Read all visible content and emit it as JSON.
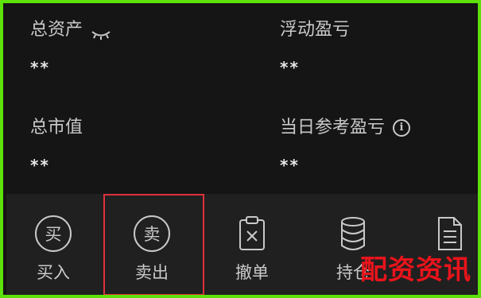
{
  "summary": {
    "total_assets": {
      "label": "总资产",
      "value": "**"
    },
    "floating_pl": {
      "label": "浮动盈亏",
      "value": "**"
    },
    "market_value": {
      "label": "总市值",
      "value": "**"
    },
    "day_pl": {
      "label": "当日参考盈亏",
      "value": "**",
      "info_icon": "i"
    }
  },
  "toolbar": {
    "buy": {
      "icon_glyph": "买",
      "label": "买入"
    },
    "sell": {
      "icon_glyph": "卖",
      "label": "卖出"
    },
    "cancel": {
      "label": "撤单"
    },
    "hold": {
      "label": "持仓"
    },
    "query": {
      "label": ""
    }
  },
  "watermark": "配资资讯",
  "colors": {
    "frame_border": "#5ee10a",
    "background": "#141414",
    "toolbar_bg": "#202020",
    "text": "#c9c9c9",
    "highlight": "#e0303a",
    "watermark": "#e8141c"
  },
  "icons": {
    "total_assets": "eye-closed-icon",
    "day_pl": "info-icon",
    "buy": "buy-circle-icon",
    "sell": "sell-circle-icon",
    "cancel": "clipboard-x-icon",
    "hold": "database-icon",
    "query": "document-icon"
  }
}
